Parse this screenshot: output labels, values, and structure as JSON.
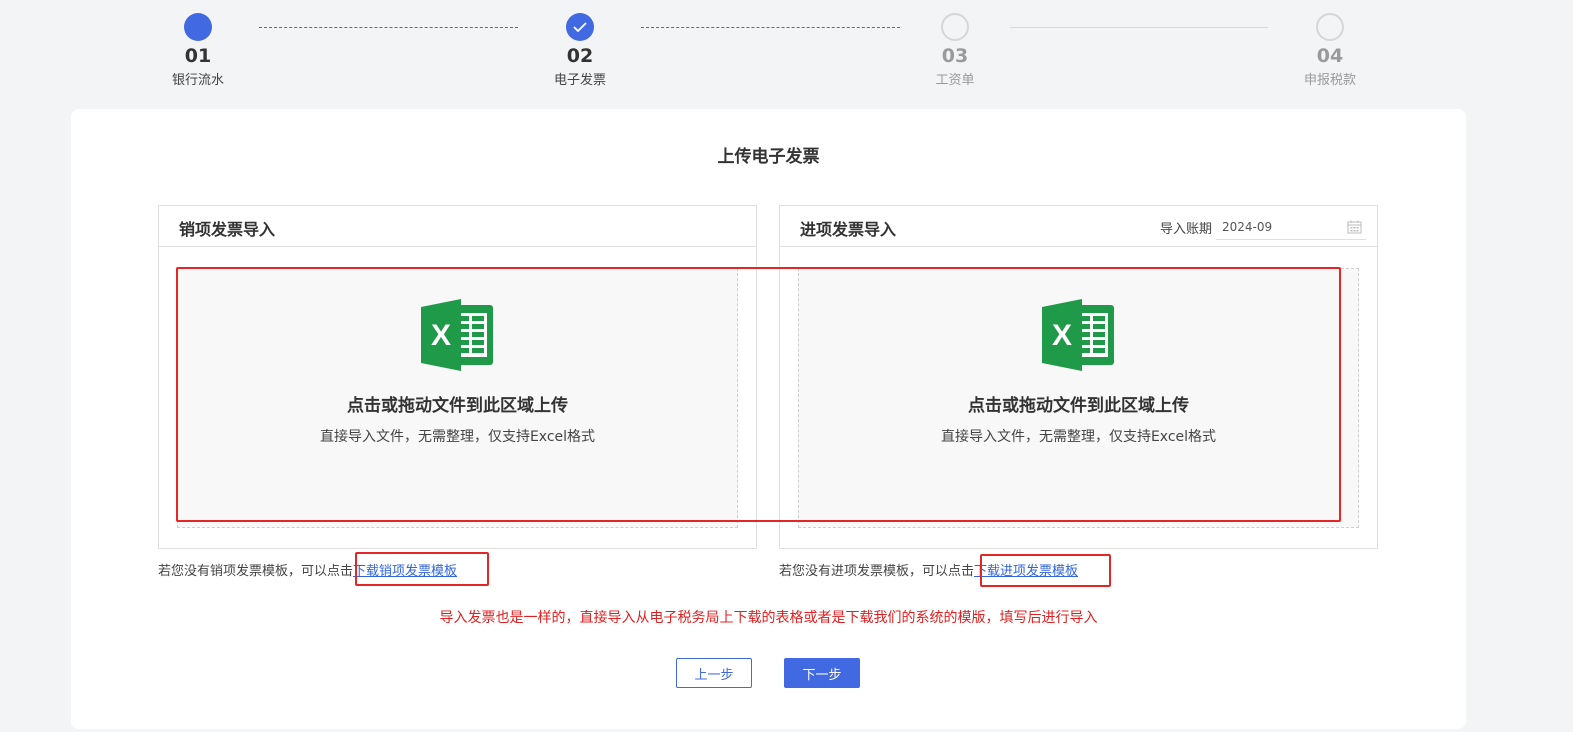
{
  "steps": [
    {
      "num": "01",
      "label": "银行流水",
      "state": "current"
    },
    {
      "num": "02",
      "label": "电子发票",
      "state": "done"
    },
    {
      "num": "03",
      "label": "工资单",
      "state": "pending"
    },
    {
      "num": "04",
      "label": "申报税款",
      "state": "pending"
    }
  ],
  "card": {
    "title": "上传电子发票"
  },
  "sales_panel": {
    "title": "销项发票导入",
    "drop_main": "点击或拖动文件到此区域上传",
    "drop_sub": "直接导入文件，无需整理，仅支持Excel格式",
    "hint_prefix": "若您没有销项发票模板，可以点击",
    "hint_link": "下载销项发票模板"
  },
  "purchase_panel": {
    "title": "进项发票导入",
    "period_label": "导入账期",
    "period_value": "2024-09",
    "drop_main": "点击或拖动文件到此区域上传",
    "drop_sub": "直接导入文件，无需整理，仅支持Excel格式",
    "hint_prefix": "若您没有进项发票模板，可以点击",
    "hint_link": "下载进项发票模板"
  },
  "note": "导入发票也是一样的，直接导入从电子税务局上下载的表格或者是下载我们的系统的模版，填写后进行导入",
  "buttons": {
    "prev": "上一步",
    "next": "下一步"
  },
  "colors": {
    "primary": "#4169e1",
    "excel_green": "#1f9a48",
    "annotation_red": "#e52626"
  }
}
